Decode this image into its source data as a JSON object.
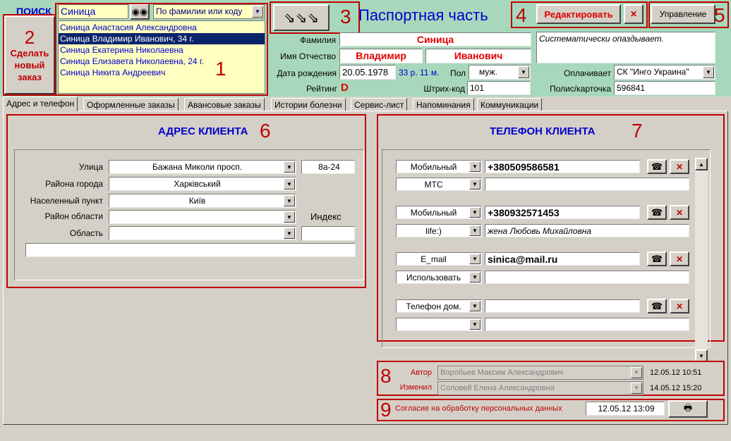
{
  "search": {
    "label": "ПОИСК",
    "query": "Синица",
    "mode": "По фамилии или коду",
    "results": [
      "Синица Анастасия Александровна",
      "Синица Владимир Иванович, 34 г.",
      "Синица Екатерина Николаевна",
      "Синица Елизавета Николаевна, 24 г.",
      "Синица Никита Андреевич"
    ]
  },
  "new_order": {
    "label": "Сделать новый заказ"
  },
  "passport": {
    "title": "Паспортная часть",
    "edit_label": "Редактировать",
    "manage_label": "Управление",
    "surname_label": "Фамилия",
    "surname": "Синица",
    "name_label": "Имя Отчество",
    "first_name": "Владимир",
    "patronymic": "Иванович",
    "dob_label": "Дата рождения",
    "dob": "20.05.1978",
    "age": "33 р. 11 м.",
    "sex_label": "Пол",
    "sex": "муж.",
    "rating_label": "Рейтинг",
    "rating": "D",
    "barcode_label": "Штрих-код",
    "barcode": "101",
    "note": "Систематически опаздывает.",
    "payer_label": "Оплачивает",
    "payer": "СК \"Инго Украина\"",
    "policy_label": "Полис/карточка",
    "policy": "596841"
  },
  "tabs": [
    "Адрес и телефон",
    "Оформленные заказы",
    "Авансовые заказы",
    "Истории болезни",
    "Сервис-лист",
    "Напоминания",
    "Коммуникации"
  ],
  "address": {
    "title": "АДРЕС КЛИЕНТА",
    "street_label": "Улица",
    "street": "Бажана Миколи просп.",
    "house": "8а-24",
    "district_label": "Района города",
    "district": "Харківський",
    "locality_label": "Населенный пункт",
    "locality": "Київ",
    "region_district_label": "Район области",
    "region_district": "",
    "index_label": "Индекс",
    "index": "",
    "region_label": "Область",
    "region": "",
    "extra": ""
  },
  "phones": {
    "title": "ТЕЛЕФОН КЛИЕНТА",
    "entries": [
      {
        "type": "Мобильный",
        "value": "+380509586581",
        "subtype": "МТС",
        "note": ""
      },
      {
        "type": "Мобильный",
        "value": "+380932571453",
        "subtype": "life:)",
        "note": "жена Любовь Михайловна"
      },
      {
        "type": "E_mail",
        "value": "sinica@mail.ru",
        "subtype": "Использовать",
        "note": ""
      },
      {
        "type": "Телефон дом.",
        "value": "",
        "subtype": "",
        "note": ""
      }
    ]
  },
  "audit": {
    "author_label": "Автор",
    "author": "Воробьев Максим Александрович",
    "author_time": "12.05.12 10:51",
    "changed_label": "Изменил",
    "changed": "Соловей Елена Александровна",
    "changed_time": "14.05.12 15:20"
  },
  "consent": {
    "label": "Согласие на обработку персональных данных",
    "date": "12.05.12 13:09"
  },
  "markers": [
    "1",
    "2",
    "3",
    "4",
    "5",
    "6",
    "7",
    "8",
    "9"
  ],
  "colors": {
    "top_bg": "#a8d8bc",
    "marker_red": "#c00000",
    "title_blue": "#0000cc"
  }
}
